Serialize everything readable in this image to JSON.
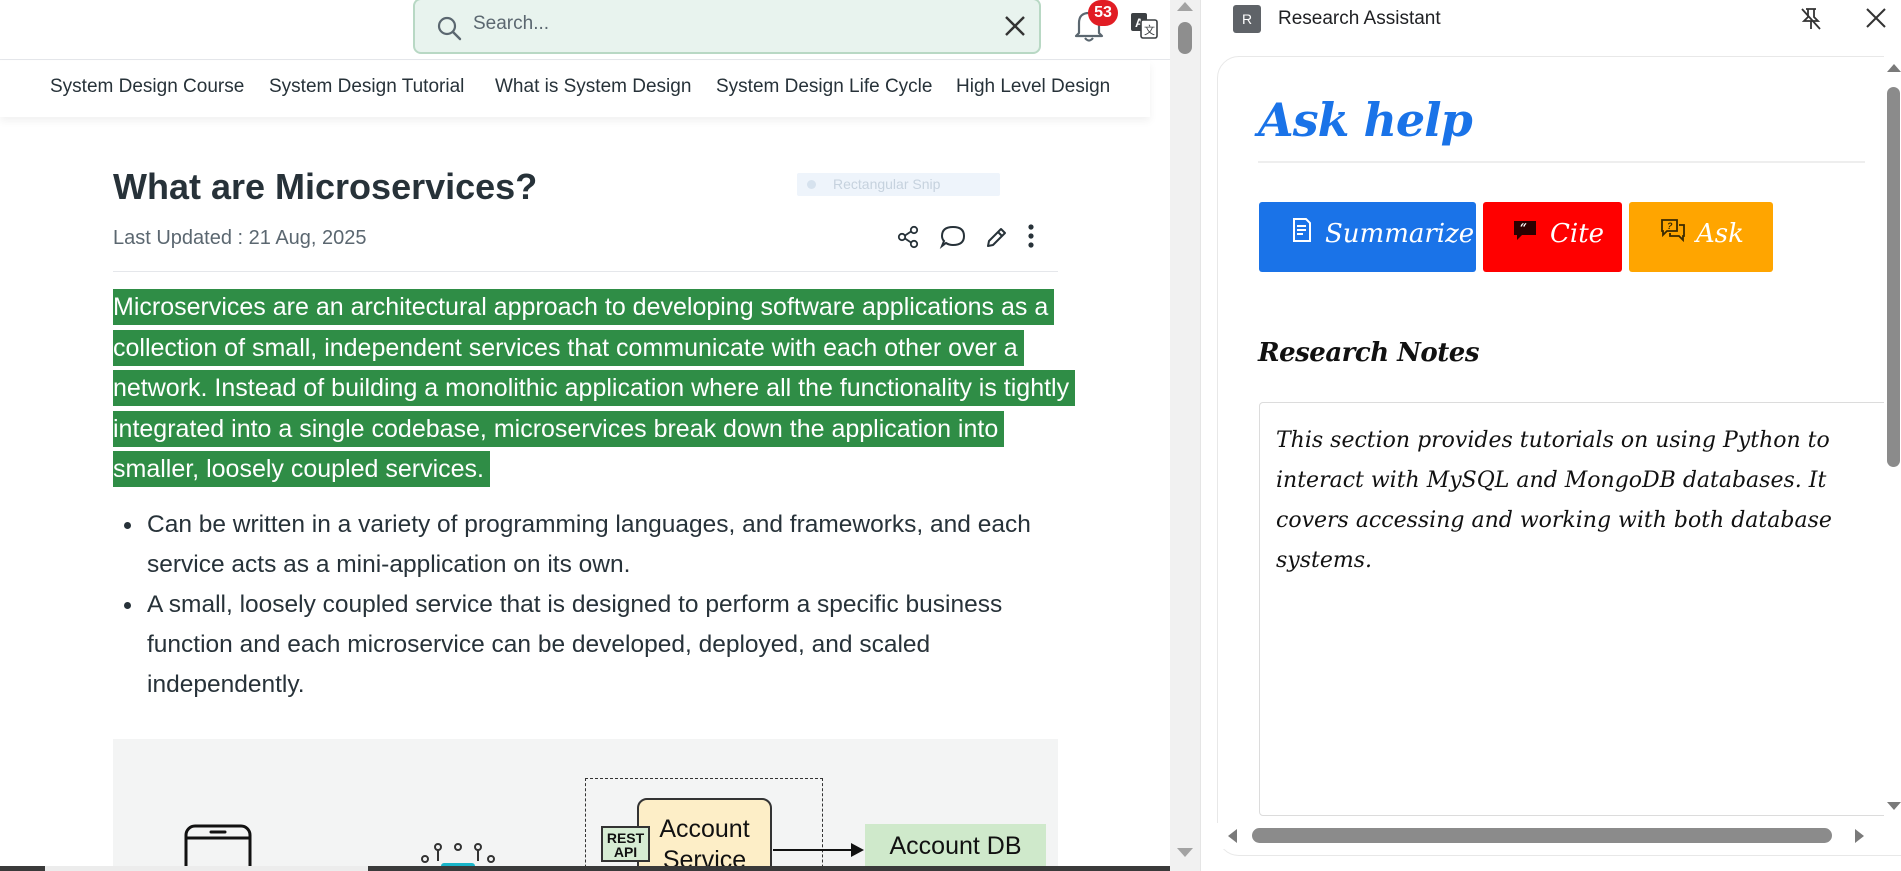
{
  "header": {
    "search_placeholder": "Search...",
    "notification_count": "53"
  },
  "nav": {
    "items": [
      {
        "label": "System Design Course"
      },
      {
        "label": "System Design Tutorial"
      },
      {
        "label": "What is System Design"
      },
      {
        "label": "System Design Life Cycle"
      },
      {
        "label": "High Level Design"
      }
    ]
  },
  "article": {
    "title": "What are Microservices?",
    "last_updated": "Last Updated : 21 Aug, 2025",
    "snip_overlay": "Rectangular Snip",
    "intro": "Microservices are an architectural approach to developing software applications as a collection of small, independent services that communicate with each other over a network. Instead of building a monolithic application where all the functionality is tightly integrated into a single codebase, microservices break down the application into smaller, loosely coupled services.",
    "bullets": [
      "Can be written in a variety of programming languages, and frameworks, and each service acts as a mini-application on its own.",
      "A small, loosely coupled service that is designed to perform a specific business function and each microservice can be developed, deployed, and scaled independently."
    ],
    "figure": {
      "rest_label": "REST API",
      "account_service": "Account Service",
      "account_db": "Account DB"
    }
  },
  "panel": {
    "favicon_letter": "R",
    "title": "Research Assistant",
    "heading": "Ask help",
    "buttons": {
      "summarize": "Summarize",
      "cite": "Cite",
      "ask": "Ask"
    },
    "notes_heading": "Research Notes",
    "notes_text": "This section provides tutorials on using Python to interact with MySQL and MongoDB databases. It covers accessing and working with both database systems."
  },
  "colors": {
    "highlight": "#2f8d46",
    "summarize": "#1a73e8",
    "cite": "#ff0000",
    "ask": "#ffa500",
    "badge": "#e11d24"
  }
}
